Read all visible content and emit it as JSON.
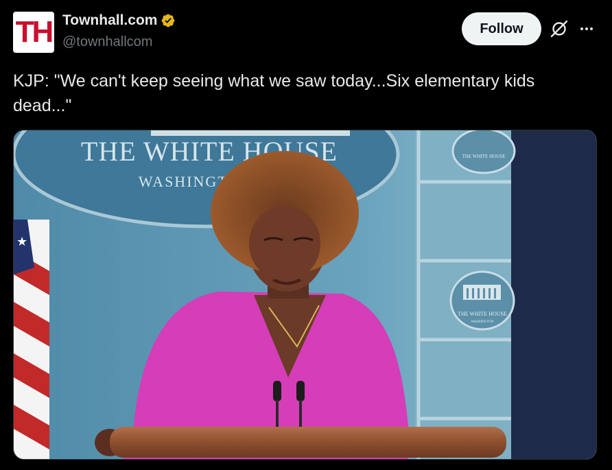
{
  "author": {
    "avatar_text": "TH",
    "display_name": "Townhall.com",
    "handle": "@townhallcom",
    "verified_badge": "gold-verified-badge-icon"
  },
  "actions": {
    "follow_label": "Follow",
    "grok_icon": "grok-icon",
    "more_icon": "more-icon"
  },
  "tweet": {
    "text": "KJP: \"We can't keep seeing what we saw today...Six elementary kids dead...\""
  },
  "media": {
    "seal_text_main": "THE WHITE HOUSE",
    "seal_text_sub": "WASHINGTON",
    "small_seal_text": "THE WHITE HOUSE",
    "small_seal_sub": "WASHINGTON"
  },
  "colors": {
    "background": "#000000",
    "text": "#e7e9ea",
    "secondary_text": "#71767b",
    "follow_bg": "#eff3f4",
    "verified_gold": "#e2b719",
    "brand_red": "#c8102e"
  }
}
